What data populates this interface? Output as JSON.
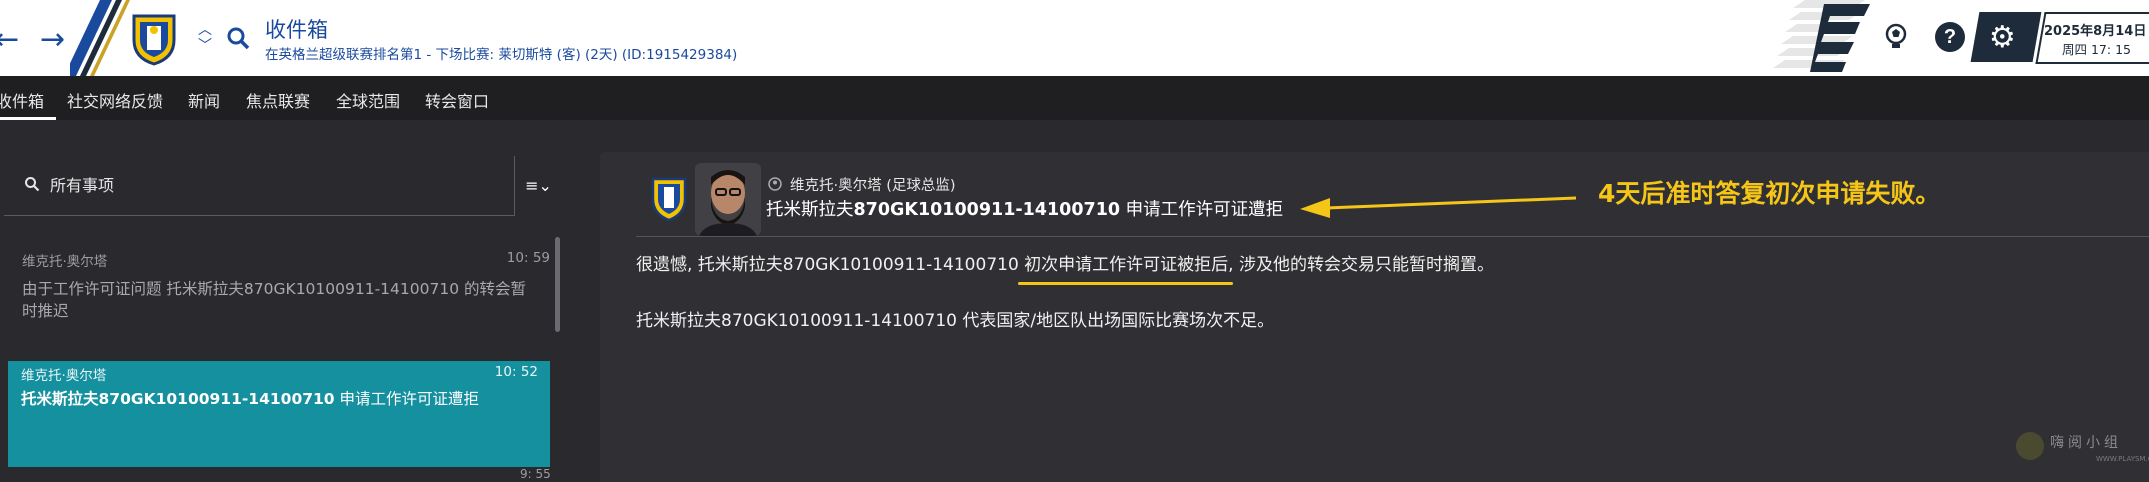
{
  "header": {
    "title": "收件箱",
    "subtitle": "在英格兰超级联赛排名第1 - 下场比赛: 莱切斯特 (客) (2天) (ID:1915429384)",
    "date": "2025年8月14日",
    "time": "周四 17: 15",
    "help_glyph": "?",
    "icons": [
      "back-arrow-icon",
      "forward-arrow-icon",
      "club-crest-icon",
      "chevron-up-icon",
      "chevron-down-icon",
      "search-icon",
      "football-icon",
      "help-icon",
      "gear-icon"
    ],
    "accent_color": "#1a4a9e"
  },
  "tabs": [
    {
      "label": "收件箱",
      "active": true
    },
    {
      "label": "社交网络反馈",
      "active": false
    },
    {
      "label": "新闻",
      "active": false
    },
    {
      "label": "焦点联赛",
      "active": false
    },
    {
      "label": "全球范围",
      "active": false
    },
    {
      "label": "转会窗口",
      "active": false
    }
  ],
  "inbox": {
    "search_text": "所有事项",
    "messages": [
      {
        "sender": "维克托·奥尔塔",
        "time": "10: 59",
        "subject": "由于工作许可证问题 托米斯拉夫870GK10100911-14100710 的转会暂时推迟",
        "selected": false
      },
      {
        "sender": "维克托·奥尔塔",
        "time": "10: 52",
        "subject_name": "托米斯拉夫870GK10100911-14100710",
        "subject_rest": " 申请工作许可证遭拒",
        "selected": true
      }
    ],
    "partial_time": "9: 55",
    "selected_color": "#15909f"
  },
  "message_view": {
    "sender": "维克托·奥尔塔",
    "sender_role": "(足球总监)",
    "subject_prefix": "托米斯拉夫",
    "subject_bold": "870GK10100911-14100710",
    "subject_suffix": " 申请工作许可证遭拒",
    "body_line1": "很遗憾, 托米斯拉夫870GK10100911-14100710 初次申请工作许可证被拒后, 涉及他的转会交易只能暂时搁置。",
    "body_line2": "托米斯拉夫870GK10100911-14100710 代表国家/地区队出场国际比赛场次不足。"
  },
  "annotation": {
    "text": "4天后准时答复初次申请失败。",
    "color": "#f5c518"
  },
  "watermark": {
    "text": "嗨阅小组",
    "sub": "WWW.PLAYSM.CC"
  }
}
